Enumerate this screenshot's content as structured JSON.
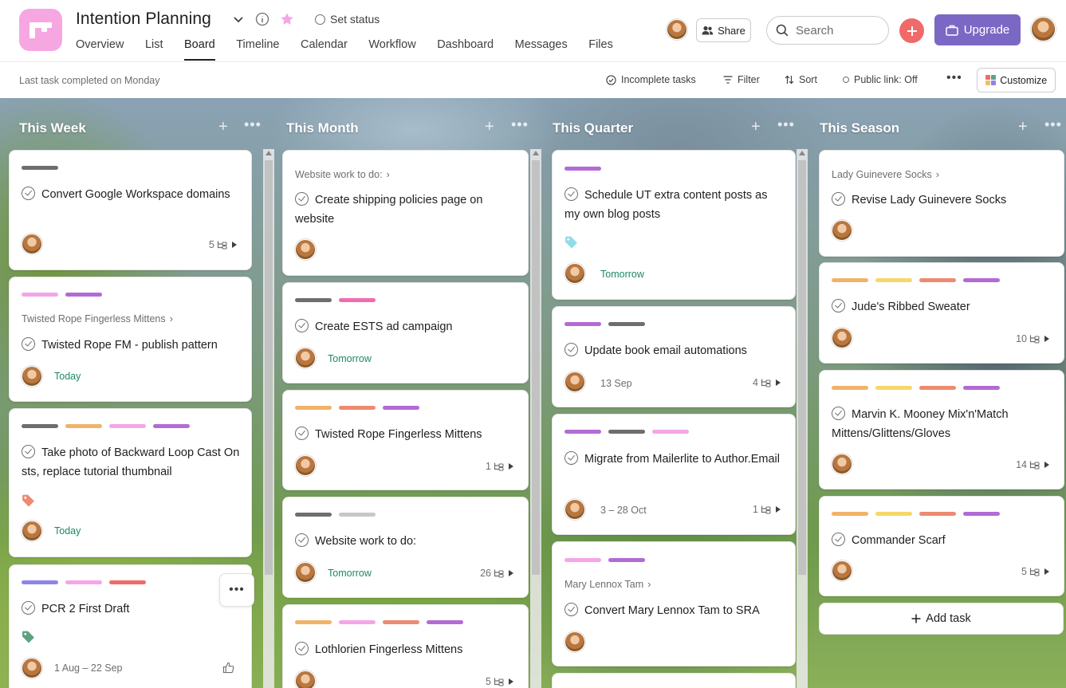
{
  "project": {
    "title": "Intention Planning",
    "set_status": "Set status",
    "tabs": [
      "Overview",
      "List",
      "Board",
      "Timeline",
      "Calendar",
      "Workflow",
      "Dashboard",
      "Messages",
      "Files"
    ],
    "active_tab": "Board"
  },
  "header": {
    "share_label": "Share",
    "search_placeholder": "Search",
    "upgrade_label": "Upgrade"
  },
  "toolbar": {
    "last_task": "Last task completed on Monday",
    "incomplete": "Incomplete tasks",
    "filter": "Filter",
    "sort": "Sort",
    "public_link": "Public link: Off",
    "customize": "Customize"
  },
  "colors": {
    "gray": "#6d6e6f",
    "pink": "#f4a6e8",
    "purple": "#b36bd4",
    "hotpink": "#f06bb2",
    "lightgray": "#c7c7c7",
    "orange": "#f0b36a",
    "yellow": "#f5d86a",
    "salmon": "#ec8b71",
    "blue": "#8d84e8",
    "red": "#f06a6a",
    "green_due": "#1a8a5f"
  },
  "columns": [
    {
      "title": "This Week",
      "cards": [
        {
          "tags": [
            "gray"
          ],
          "title": "Convert Google Workspace domains",
          "subtasks": "5"
        },
        {
          "tags": [
            "pink",
            "purple"
          ],
          "parent": "Twisted Rope Fingerless Mittens",
          "title": "Twisted Rope FM - publish pattern",
          "due": "Today"
        },
        {
          "tags": [
            "gray",
            "orange",
            "pink",
            "purple"
          ],
          "title": "Take photo of Backward Loop Cast On sts, replace tutorial thumbnail",
          "due": "Today"
        },
        {
          "tags": [
            "blue",
            "pink",
            "red"
          ],
          "title": "PCR 2 First Draft",
          "due": "1 Aug – 22 Sep"
        }
      ]
    },
    {
      "title": "This Month",
      "cards": [
        {
          "parent": "Website work to do:",
          "title": "Create shipping policies page on website"
        },
        {
          "tags": [
            "gray",
            "hotpink"
          ],
          "title": "Create ESTS ad campaign",
          "due": "Tomorrow"
        },
        {
          "tags": [
            "orange",
            "salmon",
            "purple"
          ],
          "title": "Twisted Rope Fingerless Mittens",
          "subtasks": "1"
        },
        {
          "tags": [
            "gray",
            "lightgray"
          ],
          "title": "Website work to do:",
          "due": "Tomorrow",
          "subtasks": "26"
        },
        {
          "tags": [
            "orange",
            "pink",
            "salmon",
            "purple"
          ],
          "title": "Lothlorien Fingerless Mittens",
          "subtasks": "5"
        }
      ]
    },
    {
      "title": "This Quarter",
      "cards": [
        {
          "tags": [
            "purple"
          ],
          "title": "Schedule UT extra content posts as my own blog posts",
          "due": "Tomorrow"
        },
        {
          "tags": [
            "purple",
            "gray"
          ],
          "title": "Update book email automations",
          "due": "13 Sep",
          "subtasks": "4"
        },
        {
          "tags": [
            "purple",
            "gray",
            "pink"
          ],
          "title": "Migrate from Mailerlite to Author.Email",
          "due": "3 – 28 Oct",
          "subtasks": "1"
        },
        {
          "tags": [
            "pink",
            "purple"
          ],
          "parent": "Mary Lennox Tam",
          "title": "Convert Mary Lennox Tam to SRA"
        }
      ]
    },
    {
      "title": "This Season",
      "cards": [
        {
          "parent": "Lady Guinevere Socks",
          "title": "Revise Lady Guinevere Socks"
        },
        {
          "tags": [
            "orange",
            "yellow",
            "salmon",
            "purple"
          ],
          "title": "Jude's Ribbed Sweater",
          "subtasks": "10"
        },
        {
          "tags": [
            "orange",
            "yellow",
            "salmon",
            "purple"
          ],
          "title": "Marvin K. Mooney Mix'n'Match Mittens/Glittens/Gloves",
          "subtasks": "14"
        },
        {
          "tags": [
            "orange",
            "yellow",
            "salmon",
            "purple"
          ],
          "title": "Commander Scarf",
          "subtasks": "5"
        }
      ],
      "add_task": "Add task"
    }
  ]
}
